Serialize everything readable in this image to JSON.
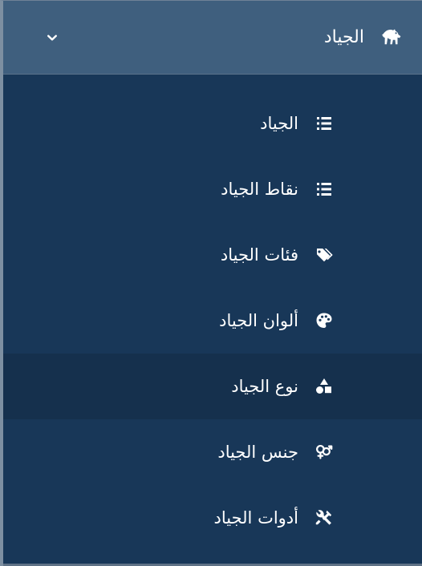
{
  "app": {
    "section_title": "الجياد"
  },
  "header": {
    "title": "الجياد",
    "icon": "horse-icon",
    "chevron_icon": "chevron-down-icon"
  },
  "menu": {
    "items": [
      {
        "label": "الجياد",
        "icon": "list-icon"
      },
      {
        "label": "نقاط الجياد",
        "icon": "list-icon"
      },
      {
        "label": "فئات الجياد",
        "icon": "tags-icon"
      },
      {
        "label": "ألوان الجياد",
        "icon": "palette-icon"
      },
      {
        "label": "نوع الجياد",
        "icon": "shapes-icon"
      },
      {
        "label": "جنس الجياد",
        "icon": "gender-icon"
      },
      {
        "label": "أدوات الجياد",
        "icon": "tools-icon"
      }
    ]
  },
  "colors": {
    "background": "#183758",
    "header_background": "#3f5f7e",
    "active_item_background": "#15304d",
    "text": "#ffffff"
  }
}
